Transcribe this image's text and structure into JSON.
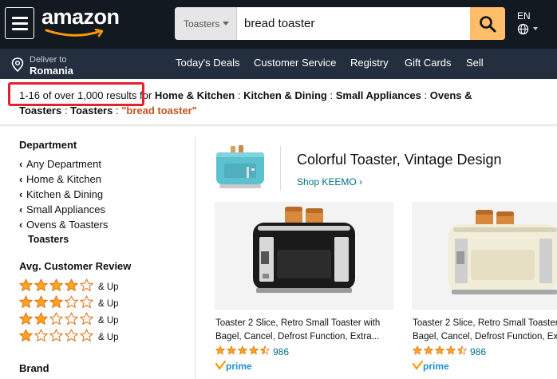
{
  "header": {
    "logo_text": "amazon",
    "search_category": "Toasters",
    "search_query": "bread toaster",
    "language": "EN"
  },
  "subnav": {
    "deliver_line1": "Deliver to",
    "deliver_line2": "Romania",
    "links": [
      "Today's Deals",
      "Customer Service",
      "Registry",
      "Gift Cards",
      "Sell"
    ]
  },
  "results": {
    "count": "1-16 of over 1,000 results",
    "for": "for",
    "breadcrumb": [
      "Home & Kitchen",
      "Kitchen & Dining",
      "Small Appliances",
      "Ovens &",
      "Toasters",
      "Toasters"
    ],
    "query": "\"bread toaster\"",
    "sep": ":"
  },
  "sidebar": {
    "department_title": "Department",
    "department_items": [
      "Any Department",
      "Home & Kitchen",
      "Kitchen & Dining",
      "Small Appliances",
      "Ovens & Toasters"
    ],
    "department_current": "Toasters",
    "review_title": "Avg. Customer Review",
    "review_up_label": "& Up",
    "review_levels": [
      4,
      3,
      2,
      1
    ],
    "brand_title": "Brand"
  },
  "banner": {
    "title": "Colorful Toaster, Vintage Design",
    "link": "Shop KEEMO ›"
  },
  "products": [
    {
      "title_line1": "Toaster 2 Slice, Retro Small Toaster with",
      "title_line2": "Bagel, Cancel, Defrost Function, Extra...",
      "rating": 4.5,
      "reviews": "986",
      "prime": "prime",
      "color": "black"
    },
    {
      "title_line1": "Toaster 2 Slice, Retro Small Toaster with",
      "title_line2": "Bagel, Cancel, Defrost Function, Extra...",
      "rating": 4.5,
      "reviews": "986",
      "prime": "prime",
      "color": "cream"
    }
  ],
  "colors": {
    "nav_dark": "#131921",
    "nav_sub": "#232F3E",
    "search_button": "#FEBD69",
    "star": "#FFA41C",
    "link": "#007185",
    "query": "#C7511F",
    "highlight_box": "#E0242E"
  }
}
